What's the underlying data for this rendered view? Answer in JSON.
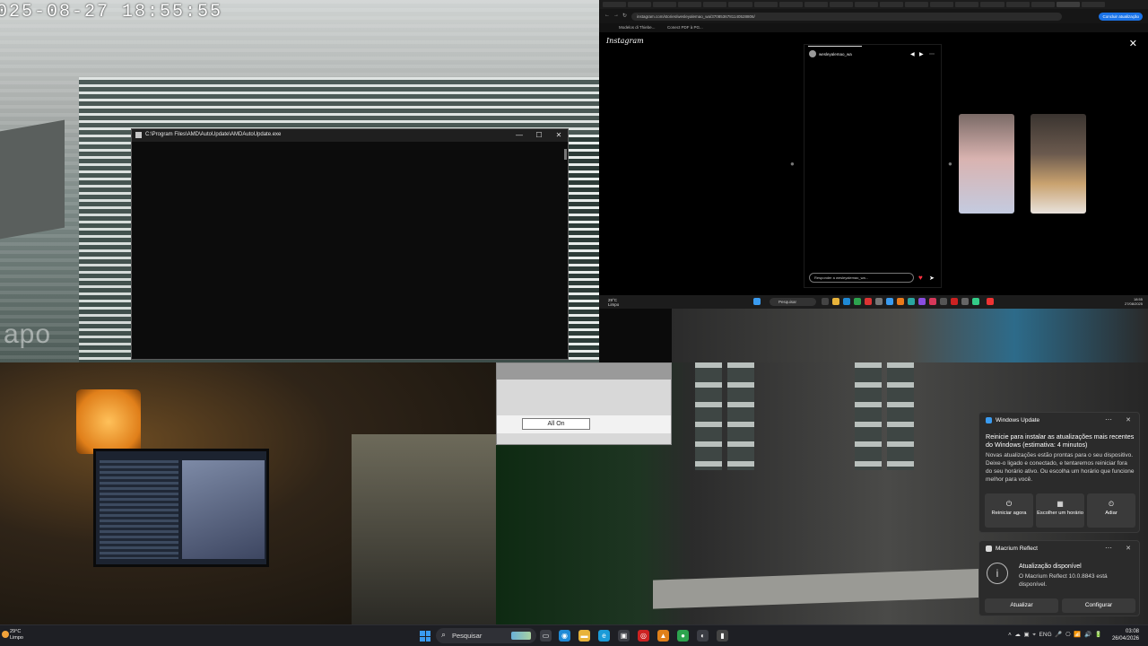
{
  "camera": {
    "timestamp": "025-08-27  18:55:55",
    "watermark": "apo"
  },
  "console": {
    "title": "C:\\Program Files\\AMD\\AutoUpdate\\AMDAutoUpdate.exe",
    "minimize": "—",
    "maximize": "☐",
    "close": "✕"
  },
  "panel": {
    "all_on_label": "All On"
  },
  "browser": {
    "url": "instagram.com/stories/wesleyalemao_wa/3708536781140528806/",
    "update_button": "Concluir atualização",
    "bookmarks": [
      "Modelos di Thiebe...",
      "Conect PDF à PG..."
    ],
    "brand": "Instagram",
    "story_username": "wesleyalemao_wa",
    "reply_placeholder": "Responder a wesleyalemao_wa...",
    "taskbar": {
      "weather_temp": "29°C",
      "weather_cond": "Limpo",
      "search": "Pesquisar",
      "time": "18:55",
      "date": "27/08/2025"
    }
  },
  "toast_update": {
    "app": "Windows Update",
    "heading": "Reinicie para instalar as atualizações mais recentes do Windows (estimativa: 4 minutos)",
    "body": "Novas atualizações estão prontas para o seu dispositivo. Deixe-o ligado e conectado, e tentaremos reiniciar fora do seu horário ativo. Ou escolha um horário que funcione melhor para você.",
    "buttons": [
      {
        "icon": "⏻",
        "label": "Reiniciar agora"
      },
      {
        "icon": "▦",
        "label": "Escolher um horário"
      },
      {
        "icon": "⏲",
        "label": "Adiar"
      }
    ]
  },
  "toast_macrium": {
    "app": "Macrium Reflect",
    "heading": "Atualização disponível",
    "body": "O Macrium Reflect 10.0.8843 está disponível.",
    "buttons": [
      "Atualizar",
      "Configurar"
    ]
  },
  "taskbar": {
    "weather_temp": "29°C",
    "weather_cond": "Limpo",
    "search_placeholder": "Pesquisar",
    "language": "ENG",
    "time": "03:08",
    "date": "26/04/2026"
  },
  "colors": {
    "accent": "#1a73e8",
    "toast_bg": "#2b2b2b",
    "taskbar_bg": "#1e1f24",
    "heart": "#ff3040"
  }
}
